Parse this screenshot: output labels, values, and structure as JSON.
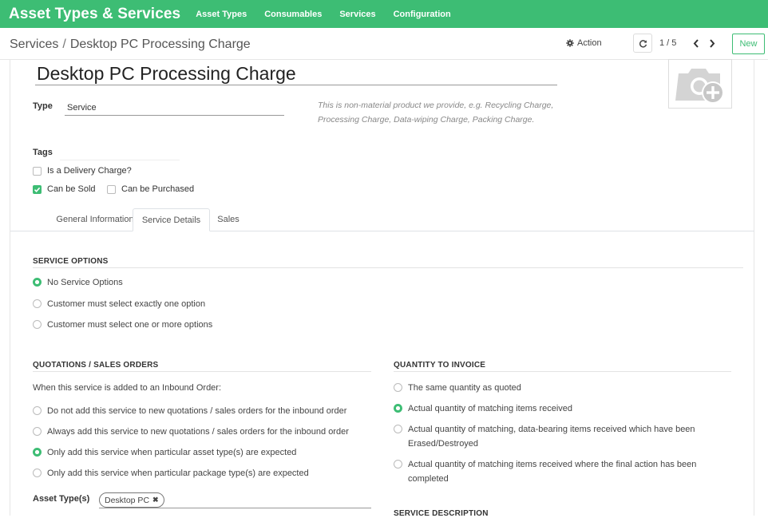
{
  "app": {
    "title": "Asset Types & Services",
    "menu": [
      "Asset Types",
      "Consumables",
      "Services",
      "Configuration"
    ]
  },
  "control": {
    "breadcrumb_parent": "Services",
    "breadcrumb_sep": "/",
    "breadcrumb_current": "Desktop PC Processing Charge",
    "action_label": "Action",
    "pager": "1 / 5",
    "new_label": "New"
  },
  "form": {
    "name": "Desktop PC Processing Charge",
    "type_label": "Type",
    "type_value": "Service",
    "type_hint": "This is non-material product we provide, e.g. Recycling Charge, Processing Charge, Data-wiping Charge, Packing Charge.",
    "tags_label": "Tags",
    "delivery_label": "Is a Delivery Charge?",
    "can_be_sold_label": "Can be Sold",
    "can_be_purchased_label": "Can be Purchased"
  },
  "tabs": [
    "General Information",
    "Service Details",
    "Sales"
  ],
  "service_options": {
    "title": "SERVICE OPTIONS",
    "options": [
      "No Service Options",
      "Customer must select exactly one option",
      "Customer must select one or more options"
    ],
    "selected": 0
  },
  "quotations": {
    "title": "QUOTATIONS / SALES ORDERS",
    "intro": "When this service is added to an Inbound Order:",
    "options": [
      "Do not add this service to new quotations / sales orders for the inbound order",
      "Always add this service to new quotations / sales orders for the inbound order",
      "Only add this service when particular asset type(s) are expected",
      "Only add this service when particular package type(s) are expected"
    ],
    "selected": 2,
    "asset_types_label": "Asset Type(s)",
    "asset_tag": "Desktop PC"
  },
  "quantity": {
    "title": "QUANTITY TO INVOICE",
    "options": [
      "The same quantity as quoted",
      "Actual quantity of matching items received",
      "Actual quantity of matching, data-bearing items received which have been Erased/Destroyed",
      "Actual quantity of matching items received where the final action has been completed"
    ],
    "selected": 1
  },
  "service_description": {
    "title": "SERVICE DESCRIPTION"
  },
  "colors": {
    "brand": "#3dbd74"
  },
  "icons": [
    "gear-icon",
    "refresh-icon",
    "chevron-left-icon",
    "chevron-right-icon",
    "camera-add-icon",
    "checkmark-icon",
    "remove-tag-icon"
  ]
}
